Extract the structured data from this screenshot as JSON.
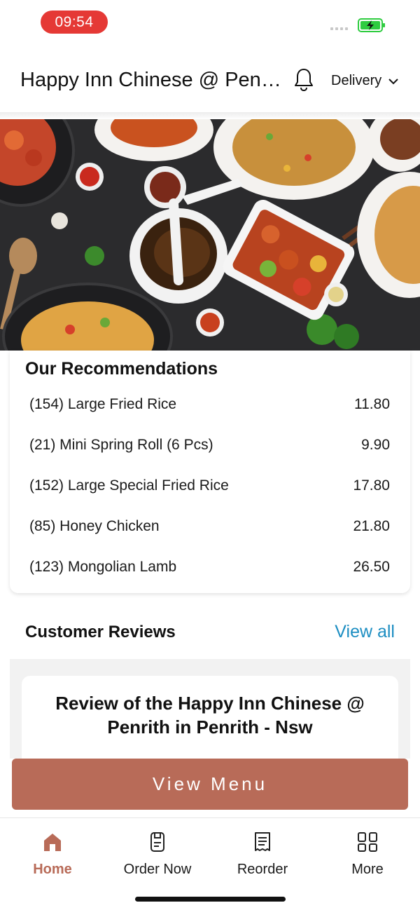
{
  "status_bar": {
    "time": "09:54"
  },
  "header": {
    "restaurant_name": "Happy Inn Chinese @ Penrith",
    "order_type": "Delivery"
  },
  "recommendations": {
    "title": "Our Recommendations",
    "items": [
      {
        "name": "(154) Large Fried Rice",
        "price": "11.80"
      },
      {
        "name": "(21) Mini Spring Roll (6 Pcs)",
        "price": "9.90"
      },
      {
        "name": "(152) Large Special Fried Rice",
        "price": "17.80"
      },
      {
        "name": "(85) Honey Chicken",
        "price": "21.80"
      },
      {
        "name": "(123) Mongolian Lamb",
        "price": "26.50"
      }
    ]
  },
  "reviews": {
    "title": "Customer Reviews",
    "view_all": "View all",
    "heading": "Review of the Happy Inn Chinese @ Penrith in Penrith - Nsw"
  },
  "cta": {
    "view_menu": "View Menu"
  },
  "tabbar": {
    "tabs": [
      {
        "label": "Home",
        "icon": "home-icon",
        "active": true
      },
      {
        "label": "Order Now",
        "icon": "order-icon",
        "active": false
      },
      {
        "label": "Reorder",
        "icon": "receipt-icon",
        "active": false
      },
      {
        "label": "More",
        "icon": "grid-icon",
        "active": false
      }
    ]
  },
  "colors": {
    "accent": "#b86b58",
    "link": "#1d8ec2",
    "time_pill": "#e53935",
    "battery": "#2ecc40"
  }
}
